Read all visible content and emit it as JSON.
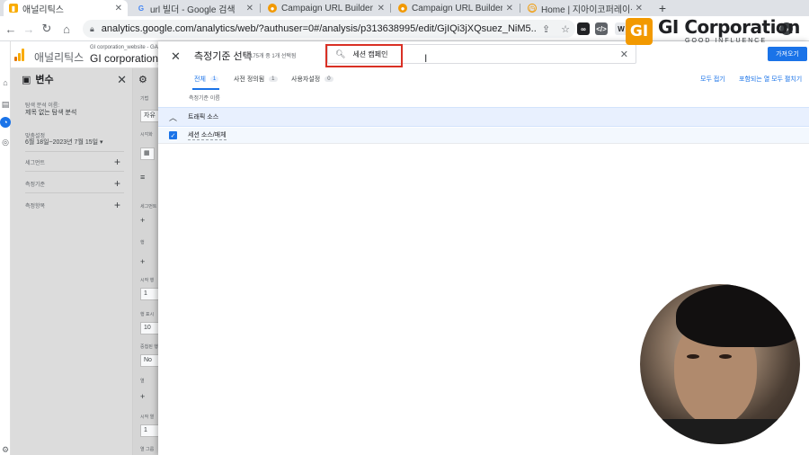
{
  "browser": {
    "tabs": [
      {
        "label": "애널리틱스",
        "icon": "analytics-icon",
        "active": true
      },
      {
        "label": "url 빌더 - Google 검색",
        "icon": "google-icon"
      },
      {
        "label": "Campaign URL Builder",
        "icon": "campaign-builder-icon"
      },
      {
        "label": "Campaign URL Builder",
        "icon": "campaign-builder-icon"
      },
      {
        "label": "Home | 지아이코퍼레이션",
        "icon": "home-site-icon"
      }
    ],
    "new_tab": "+",
    "url": "analytics.google.com/analytics/web/?authuser=0#/analysis/p313638995/edit/GjIQi3jXQsuez_NiM5..."
  },
  "ga": {
    "app_title": "애널리틱스",
    "property_small": "GI corporation_website - GA4",
    "property_name": "GI corporation_w"
  },
  "variables_panel": {
    "title": "변수",
    "exploration_name_label": "탐색 분석 이름:",
    "exploration_name": "제목 없는 탐색 분석",
    "date_label": "맞춤설정",
    "date_range": "6월 18일~2023년 7월 15일",
    "sections": [
      {
        "label": "세그먼트"
      },
      {
        "label": "측정기준"
      },
      {
        "label": "측정항목"
      }
    ]
  },
  "settings_panel": {
    "title": "설",
    "labels": [
      "기법",
      "시각화",
      "세그먼트",
      "행",
      "시작 행",
      "행 표시",
      "중첩된 행",
      "열",
      "시작 열",
      "열 그룹"
    ],
    "values": [
      "자유",
      "1",
      "10",
      "No",
      "1"
    ]
  },
  "dialog": {
    "title": "측정기준 선택",
    "subtitle": "175개 중 1개 선택됨",
    "search_value": "세션 캠페인",
    "apply_label": "가져오기",
    "tabs": [
      {
        "label": "전체",
        "count": "1"
      },
      {
        "label": "사전 정의됨",
        "count": "1"
      },
      {
        "label": "사용자설정",
        "count": "0"
      }
    ],
    "collapse_all": "모두 접기",
    "expand_included": "포함되는 열 모두 펼치기",
    "column_header": "측정기준 이름",
    "group_label": "트래픽 소스",
    "item_label": "세션 소스/매체",
    "item_checked": true
  },
  "watermark": {
    "mark": "GI",
    "name": "GI Corporation",
    "tagline": "GOOD INFLUENCE"
  },
  "colors": {
    "accent": "#1a73e8",
    "highlight_box": "#d93025",
    "brand_orange": "#f29900"
  }
}
